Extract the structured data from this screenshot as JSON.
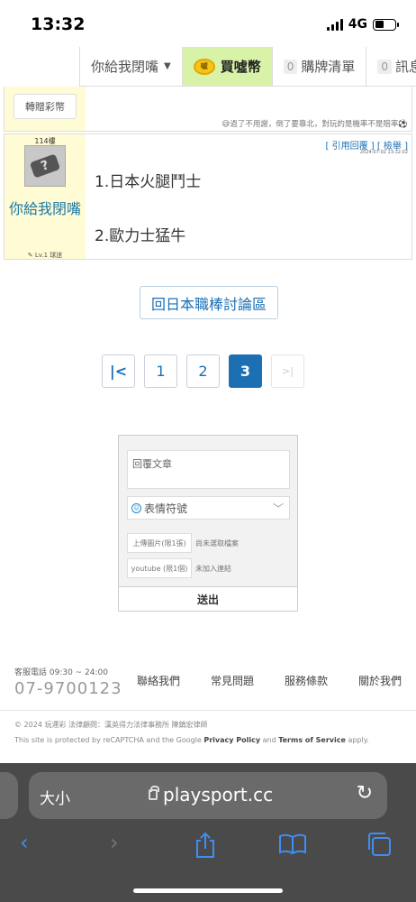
{
  "status": {
    "time": "13:32",
    "network": "4G"
  },
  "topnav": {
    "user": "你給我閉嘴",
    "coin": "買噓幣",
    "coin_icon": "coin-icon",
    "cart_count": "0",
    "cart": "購牌清單",
    "msg_count": "0",
    "msg": "訊息"
  },
  "prev_post": {
    "gift": "轉贈彩幣",
    "signature": "過了不用謝，倒了要靠北，對玩的是機率不是賠率"
  },
  "post": {
    "floor": "114樓",
    "username": "你給我閉嘴",
    "level": "Lv.1 球迷",
    "actions": "[ 引用回覆 ]  [ 檢舉 ]",
    "date": "2024-07-02 13:32:02",
    "lines": [
      "1.日本火腿鬥士",
      "2.歐力士猛牛"
    ]
  },
  "back_button": "回日本職棒討論區",
  "pager": {
    "first": "|<",
    "pages": [
      "1",
      "2",
      "3"
    ],
    "current": "3",
    "last": ">|"
  },
  "reply": {
    "placeholder": "回覆文章",
    "emoji": "表情符號",
    "upload_img": "上傳圖片(限1張)",
    "upload_img_note": "尚未選取檔案",
    "youtube": "youtube (限1個)",
    "youtube_note": "未加入連結",
    "submit": "送出"
  },
  "footer": {
    "service_label": "客服電話 09:30 ~ 24:00",
    "phone": "07-9700123",
    "links": [
      "聯絡我們",
      "常見問題",
      "服務條款",
      "關於我們"
    ],
    "copyright": "© 2024  玩運彩  法律顧問：漢英得力法律事務所 陳鎮宏律師",
    "recaptcha_pre": "This site is protected by reCAPTCHA and the Google ",
    "privacy": "Privacy Policy",
    "and": " and ",
    "terms": "Terms of Service",
    "apply": " apply."
  },
  "browser": {
    "aa": "大小",
    "url": "playsport.cc"
  }
}
